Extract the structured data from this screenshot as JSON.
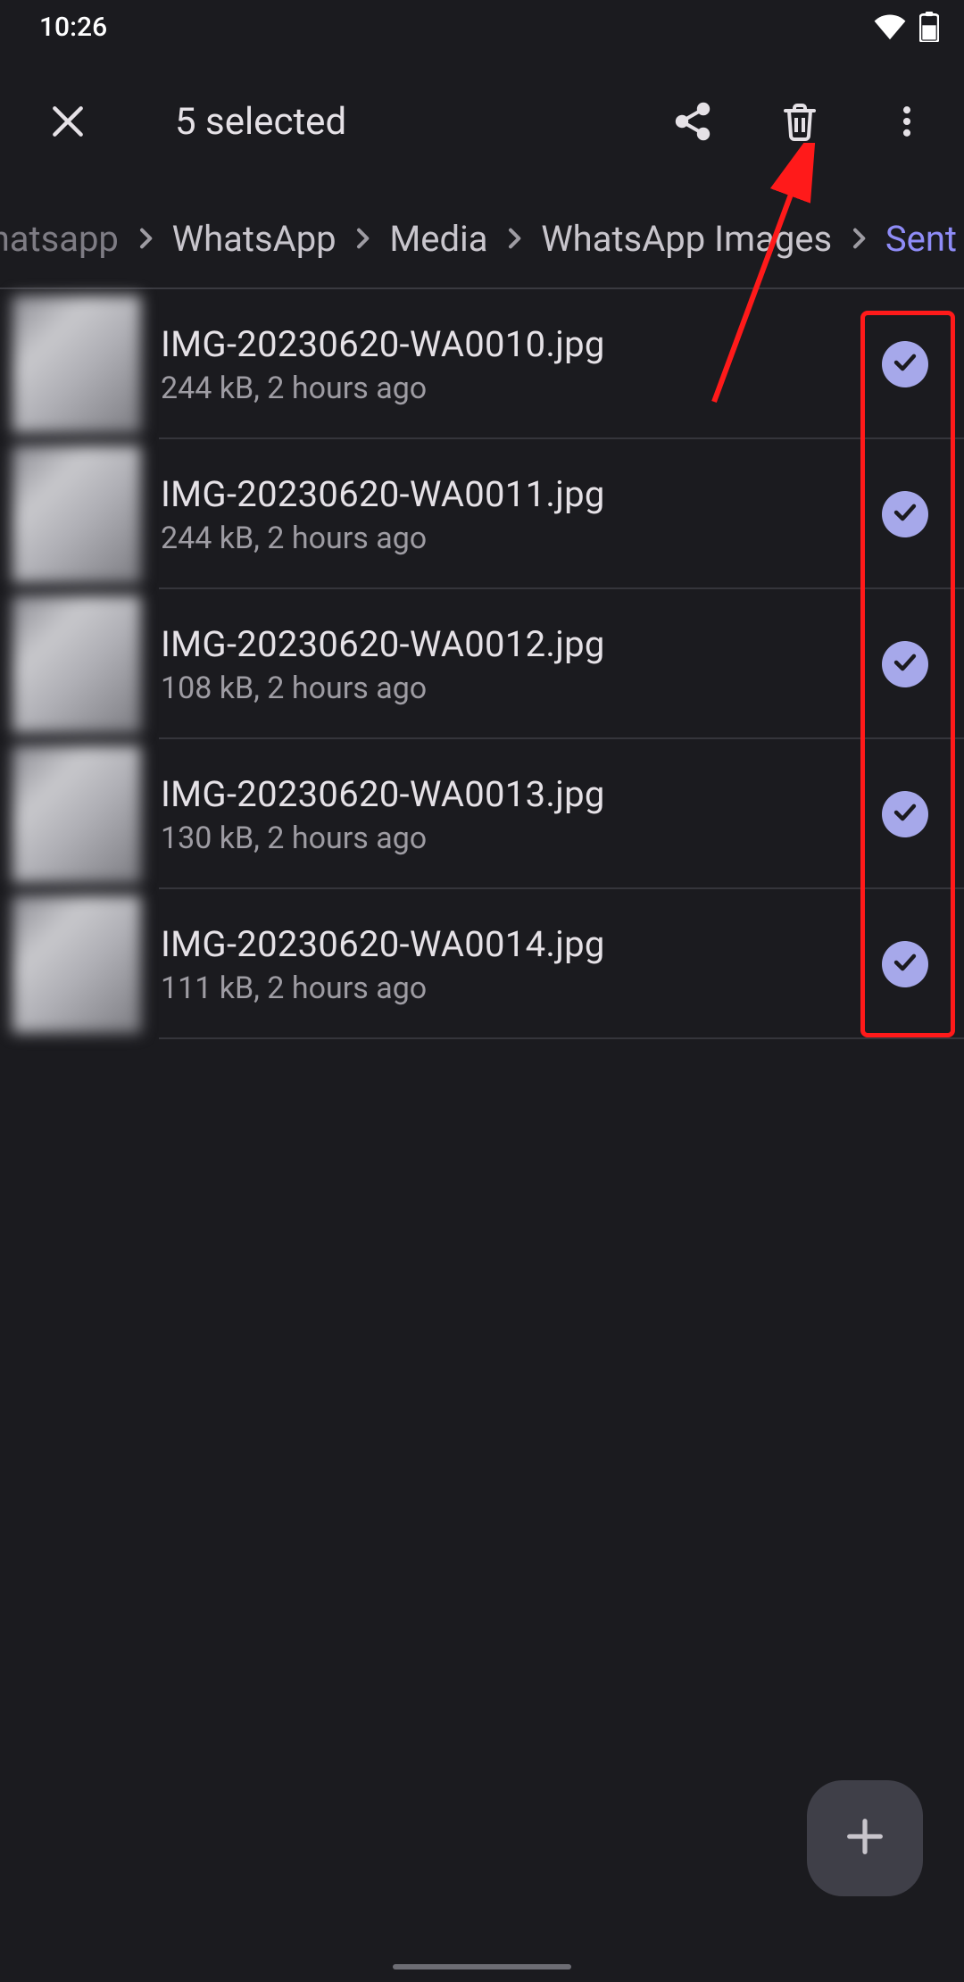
{
  "status_bar": {
    "time": "10:26"
  },
  "app_bar": {
    "title": "5 selected"
  },
  "breadcrumb": {
    "items": [
      {
        "label": "n.whatsapp",
        "current": false
      },
      {
        "label": "WhatsApp",
        "current": false
      },
      {
        "label": "Media",
        "current": false
      },
      {
        "label": "WhatsApp Images",
        "current": false
      },
      {
        "label": "Sent",
        "current": true
      }
    ]
  },
  "files": [
    {
      "name": "IMG-20230620-WA0010.jpg",
      "meta": "244 kB, 2 hours ago",
      "selected": true
    },
    {
      "name": "IMG-20230620-WA0011.jpg",
      "meta": "244 kB, 2 hours ago",
      "selected": true
    },
    {
      "name": "IMG-20230620-WA0012.jpg",
      "meta": "108 kB, 2 hours ago",
      "selected": true
    },
    {
      "name": "IMG-20230620-WA0013.jpg",
      "meta": "130 kB, 2 hours ago",
      "selected": true
    },
    {
      "name": "IMG-20230620-WA0014.jpg",
      "meta": "111 kB, 2 hours ago",
      "selected": true
    }
  ]
}
